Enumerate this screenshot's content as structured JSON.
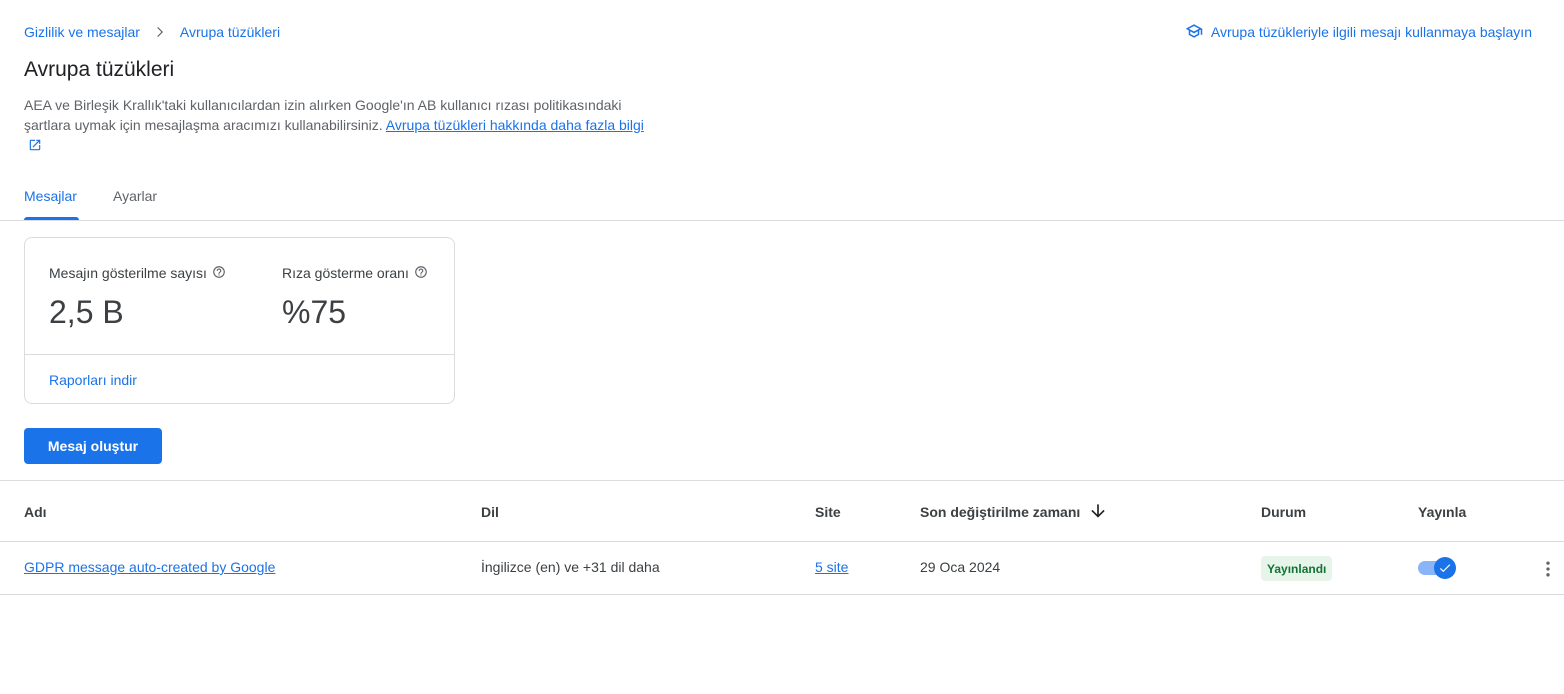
{
  "breadcrumb": {
    "items": [
      "Gizlilik ve mesajlar",
      "Avrupa tüzükleri"
    ]
  },
  "header": {
    "top_link": "Avrupa tüzükleriyle ilgili mesajı kullanmaya başlayın",
    "title": "Avrupa tüzükleri",
    "description": "AEA ve Birleşik Krallık'taki kullanıcılardan izin alırken Google'ın AB kullanıcı rızası politikasındaki şartlara uymak için mesajlaşma aracımızı kullanabilirsiniz.",
    "learn_more": "Avrupa tüzükleri hakkında daha fazla bilgi"
  },
  "tabs": [
    {
      "label": "Mesajlar",
      "active": true
    },
    {
      "label": "Ayarlar",
      "active": false
    }
  ],
  "stats": {
    "impressions_label": "Mesajın gösterilme sayısı",
    "impressions_value": "2,5 B",
    "consent_label": "Rıza gösterme oranı",
    "consent_value": "%75",
    "download_link": "Raporları indir"
  },
  "actions": {
    "create_message": "Mesaj oluştur"
  },
  "table": {
    "columns": [
      "Adı",
      "Dil",
      "Site",
      "Son değiştirilme zamanı",
      "Durum",
      "Yayınla"
    ],
    "rows": [
      {
        "name": "GDPR message auto-created by Google",
        "language": "İngilizce (en) ve +31 dil daha",
        "site": "5 site",
        "modified": "29 Oca 2024",
        "status": "Yayınlandı",
        "published": true
      }
    ]
  },
  "colors": {
    "accent": "#1a73e8",
    "status_bg": "#e6f4ea",
    "status_text": "#137333"
  }
}
